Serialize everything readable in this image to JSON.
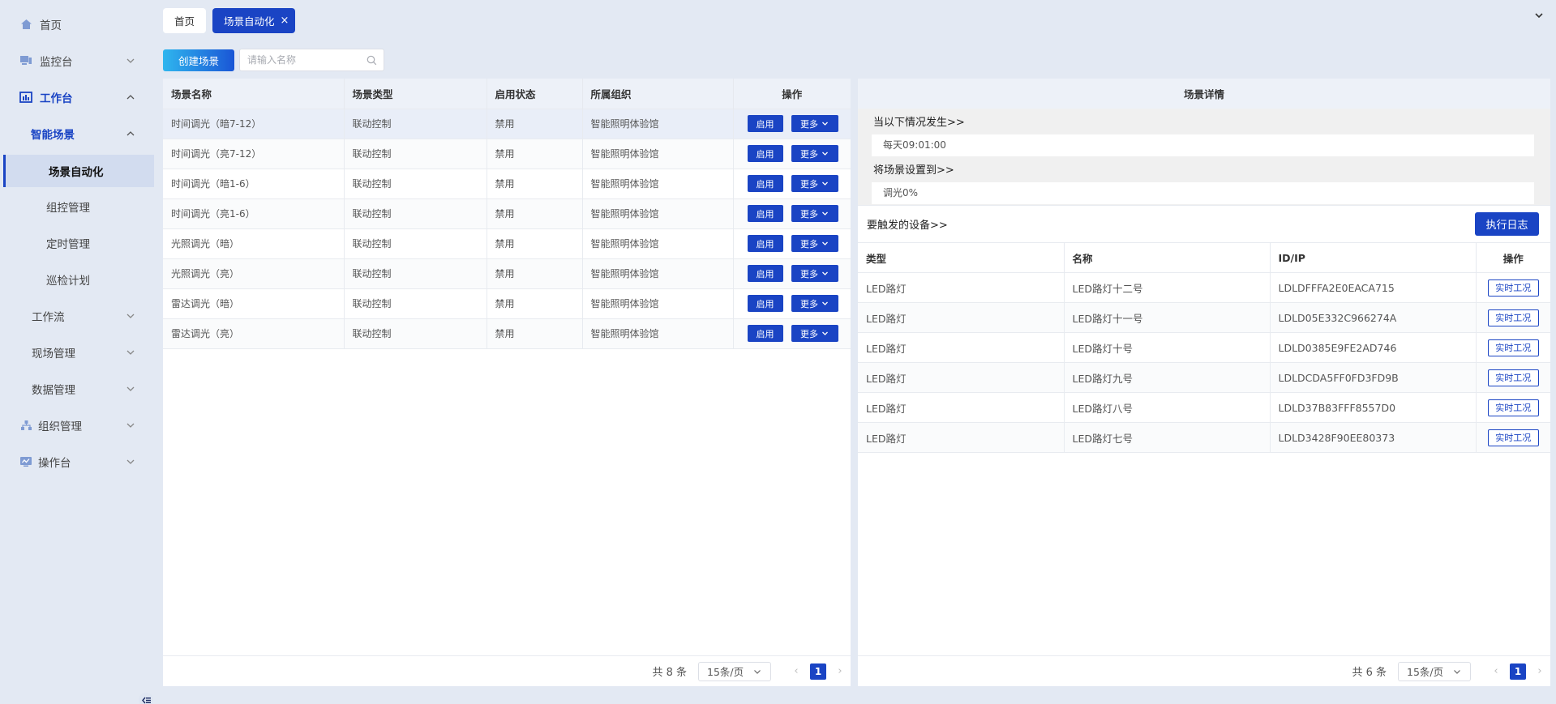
{
  "sidebar": {
    "items": [
      {
        "label": "首页",
        "icon": "home-icon"
      },
      {
        "label": "监控台",
        "icon": "monitor-icon"
      },
      {
        "label": "工作台",
        "icon": "dashboard-icon"
      },
      {
        "label": "智能场景"
      },
      {
        "label": "场景自动化"
      },
      {
        "label": "组控管理"
      },
      {
        "label": "定时管理"
      },
      {
        "label": "巡检计划"
      },
      {
        "label": "工作流"
      },
      {
        "label": "现场管理"
      },
      {
        "label": "数据管理"
      },
      {
        "label": "组织管理",
        "icon": "org-icon"
      },
      {
        "label": "操作台",
        "icon": "console-icon"
      }
    ]
  },
  "tabs": [
    {
      "label": "首页"
    },
    {
      "label": "场景自动化",
      "close": "×"
    }
  ],
  "toolbar": {
    "create_label": "创建场景",
    "search_placeholder": "请输入名称"
  },
  "scene_table": {
    "columns": [
      "场景名称",
      "场景类型",
      "启用状态",
      "所属组织",
      "操作"
    ],
    "enable_label": "启用",
    "more_label": "更多",
    "rows": [
      [
        "时间调光（暗7-12）",
        "联动控制",
        "禁用",
        "智能照明体验馆"
      ],
      [
        "时间调光（亮7-12）",
        "联动控制",
        "禁用",
        "智能照明体验馆"
      ],
      [
        "时间调光（暗1-6）",
        "联动控制",
        "禁用",
        "智能照明体验馆"
      ],
      [
        "时间调光（亮1-6）",
        "联动控制",
        "禁用",
        "智能照明体验馆"
      ],
      [
        "光照调光（暗）",
        "联动控制",
        "禁用",
        "智能照明体验馆"
      ],
      [
        "光照调光（亮）",
        "联动控制",
        "禁用",
        "智能照明体验馆"
      ],
      [
        "雷达调光（暗）",
        "联动控制",
        "禁用",
        "智能照明体验馆"
      ],
      [
        "雷达调光（亮）",
        "联动控制",
        "禁用",
        "智能照明体验馆"
      ]
    ],
    "pager": {
      "total": "共 8 条",
      "size": "15条/页",
      "page": "1"
    }
  },
  "detail": {
    "title": "场景详情",
    "when_label": "当以下情况发生>>",
    "when_value": "每天09:01:00",
    "set_label": "将场景设置到>>",
    "set_value": "调光0%",
    "devices_label": "要触发的设备>>",
    "log_button": "执行日志",
    "columns": [
      "类型",
      "名称",
      "ID/IP",
      "操作"
    ],
    "action_label": "实时工况",
    "rows": [
      [
        "LED路灯",
        "LED路灯十二号",
        "LDLDFFFA2E0EACA715"
      ],
      [
        "LED路灯",
        "LED路灯十一号",
        "LDLD05E332C966274A"
      ],
      [
        "LED路灯",
        "LED路灯十号",
        "LDLD0385E9FE2AD746"
      ],
      [
        "LED路灯",
        "LED路灯九号",
        "LDLDCDA5FF0FD3FD9B"
      ],
      [
        "LED路灯",
        "LED路灯八号",
        "LDLD37B83FFF8557D0"
      ],
      [
        "LED路灯",
        "LED路灯七号",
        "LDLD3428F90EE80373"
      ]
    ],
    "pager": {
      "total": "共 6 条",
      "size": "15条/页",
      "page": "1"
    }
  },
  "colors": {
    "primary": "#1a44c4",
    "background": "#e3e9f3"
  }
}
